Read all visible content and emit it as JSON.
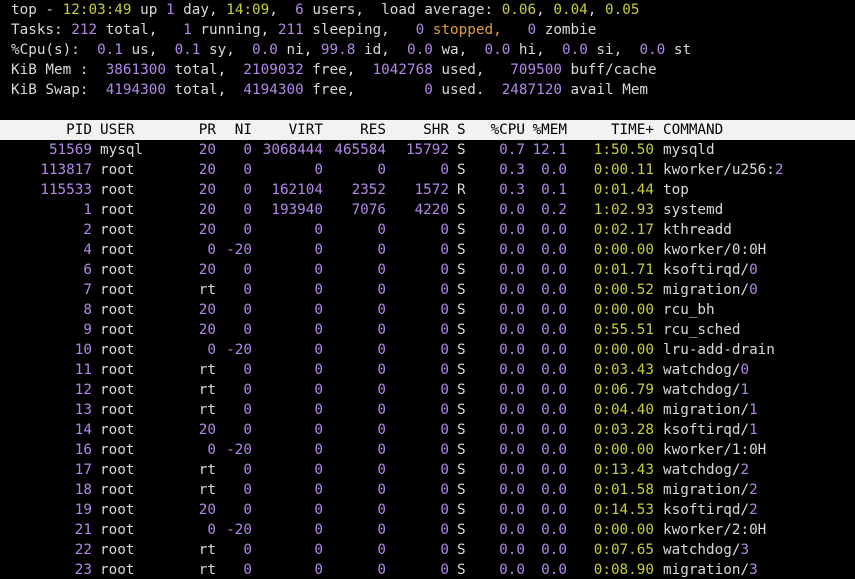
{
  "summary": {
    "top": {
      "label": "top - ",
      "time": "12:03:49",
      "up_label": " up ",
      "days": "1",
      "day_label": " day, ",
      "uptime": "14:09",
      "comma1": ",  ",
      "users": "6",
      "users_label": " users,  load average: ",
      "l1": "0.06",
      "sep1": ", ",
      "l2": "0.04",
      "sep2": ", ",
      "l3": "0.05"
    },
    "tasks": {
      "label": "Tasks: ",
      "total": "212",
      "total_label": " total,   ",
      "running": "1",
      "running_label": " running, ",
      "sleeping": "211",
      "sleeping_label": " sleeping,   ",
      "stopped": "0",
      "stopped_label": " stopped,   ",
      "zombie": "0",
      "zombie_label": " zombie"
    },
    "cpu": {
      "label": "%Cpu(s):  ",
      "us": "0.1",
      "us_label": " us,  ",
      "sy": "0.1",
      "sy_label": " sy,  ",
      "ni": "0.0",
      "ni_label": " ni, ",
      "id": "99.8",
      "id_label": " id,  ",
      "wa": "0.0",
      "wa_label": " wa,  ",
      "hi": "0.0",
      "hi_label": " hi,  ",
      "si": "0.0",
      "si_label": " si,  ",
      "st": "0.0",
      "st_label": " st"
    },
    "mem": {
      "label": "KiB Mem :  ",
      "total": "3861300",
      "total_label": " total,  ",
      "free": "2109032",
      "free_label": " free,  ",
      "used": "1042768",
      "used_label": " used,   ",
      "cache": "709500",
      "cache_label": " buff/cache"
    },
    "swap": {
      "label": "KiB Swap:  ",
      "total": "4194300",
      "total_label": " total,  ",
      "free": "4194300",
      "free_label": " free,        ",
      "used": "0",
      "used_label": " used.  ",
      "avail": "2487120",
      "avail_label": " avail Mem"
    }
  },
  "columns": [
    "PID",
    "USER",
    "PR",
    "NI",
    "VIRT",
    "RES",
    "SHR",
    "S",
    "%CPU",
    "%MEM",
    "TIME+",
    "COMMAND"
  ],
  "processes": [
    {
      "pid": "51569",
      "user": "mysql",
      "pr": "20",
      "ni": "0",
      "virt": "3068444",
      "res": "465584",
      "shr": "15792",
      "s": "S",
      "cpu": "0.7",
      "mem": "12.1",
      "time": "1:50.50",
      "cmd": "mysqld",
      "cmd_num": ""
    },
    {
      "pid": "113817",
      "user": "root",
      "pr": "20",
      "ni": "0",
      "virt": "0",
      "res": "0",
      "shr": "0",
      "s": "S",
      "cpu": "0.3",
      "mem": "0.0",
      "time": "0:00.11",
      "cmd": "kworker/u256:",
      "cmd_num": "2"
    },
    {
      "pid": "115533",
      "user": "root",
      "pr": "20",
      "ni": "0",
      "virt": "162104",
      "res": "2352",
      "shr": "1572",
      "s": "R",
      "cpu": "0.3",
      "mem": "0.1",
      "time": "0:01.44",
      "cmd": "top",
      "cmd_num": ""
    },
    {
      "pid": "1",
      "user": "root",
      "pr": "20",
      "ni": "0",
      "virt": "193940",
      "res": "7076",
      "shr": "4220",
      "s": "S",
      "cpu": "0.0",
      "mem": "0.2",
      "time": "1:02.93",
      "cmd": "systemd",
      "cmd_num": ""
    },
    {
      "pid": "2",
      "user": "root",
      "pr": "20",
      "ni": "0",
      "virt": "0",
      "res": "0",
      "shr": "0",
      "s": "S",
      "cpu": "0.0",
      "mem": "0.0",
      "time": "0:02.17",
      "cmd": "kthreadd",
      "cmd_num": ""
    },
    {
      "pid": "4",
      "user": "root",
      "pr": "0",
      "ni": "-20",
      "virt": "0",
      "res": "0",
      "shr": "0",
      "s": "S",
      "cpu": "0.0",
      "mem": "0.0",
      "time": "0:00.00",
      "cmd": "kworker/0:0H",
      "cmd_num": ""
    },
    {
      "pid": "6",
      "user": "root",
      "pr": "20",
      "ni": "0",
      "virt": "0",
      "res": "0",
      "shr": "0",
      "s": "S",
      "cpu": "0.0",
      "mem": "0.0",
      "time": "0:01.71",
      "cmd": "ksoftirqd/",
      "cmd_num": "0"
    },
    {
      "pid": "7",
      "user": "root",
      "pr": "rt",
      "ni": "0",
      "virt": "0",
      "res": "0",
      "shr": "0",
      "s": "S",
      "cpu": "0.0",
      "mem": "0.0",
      "time": "0:00.52",
      "cmd": "migration/",
      "cmd_num": "0"
    },
    {
      "pid": "8",
      "user": "root",
      "pr": "20",
      "ni": "0",
      "virt": "0",
      "res": "0",
      "shr": "0",
      "s": "S",
      "cpu": "0.0",
      "mem": "0.0",
      "time": "0:00.00",
      "cmd": "rcu_bh",
      "cmd_num": ""
    },
    {
      "pid": "9",
      "user": "root",
      "pr": "20",
      "ni": "0",
      "virt": "0",
      "res": "0",
      "shr": "0",
      "s": "S",
      "cpu": "0.0",
      "mem": "0.0",
      "time": "0:55.51",
      "cmd": "rcu_sched",
      "cmd_num": ""
    },
    {
      "pid": "10",
      "user": "root",
      "pr": "0",
      "ni": "-20",
      "virt": "0",
      "res": "0",
      "shr": "0",
      "s": "S",
      "cpu": "0.0",
      "mem": "0.0",
      "time": "0:00.00",
      "cmd": "lru-add-drain",
      "cmd_num": ""
    },
    {
      "pid": "11",
      "user": "root",
      "pr": "rt",
      "ni": "0",
      "virt": "0",
      "res": "0",
      "shr": "0",
      "s": "S",
      "cpu": "0.0",
      "mem": "0.0",
      "time": "0:03.43",
      "cmd": "watchdog/",
      "cmd_num": "0"
    },
    {
      "pid": "12",
      "user": "root",
      "pr": "rt",
      "ni": "0",
      "virt": "0",
      "res": "0",
      "shr": "0",
      "s": "S",
      "cpu": "0.0",
      "mem": "0.0",
      "time": "0:06.79",
      "cmd": "watchdog/",
      "cmd_num": "1"
    },
    {
      "pid": "13",
      "user": "root",
      "pr": "rt",
      "ni": "0",
      "virt": "0",
      "res": "0",
      "shr": "0",
      "s": "S",
      "cpu": "0.0",
      "mem": "0.0",
      "time": "0:04.40",
      "cmd": "migration/",
      "cmd_num": "1"
    },
    {
      "pid": "14",
      "user": "root",
      "pr": "20",
      "ni": "0",
      "virt": "0",
      "res": "0",
      "shr": "0",
      "s": "S",
      "cpu": "0.0",
      "mem": "0.0",
      "time": "0:03.28",
      "cmd": "ksoftirqd/",
      "cmd_num": "1"
    },
    {
      "pid": "16",
      "user": "root",
      "pr": "0",
      "ni": "-20",
      "virt": "0",
      "res": "0",
      "shr": "0",
      "s": "S",
      "cpu": "0.0",
      "mem": "0.0",
      "time": "0:00.00",
      "cmd": "kworker/1:0H",
      "cmd_num": ""
    },
    {
      "pid": "17",
      "user": "root",
      "pr": "rt",
      "ni": "0",
      "virt": "0",
      "res": "0",
      "shr": "0",
      "s": "S",
      "cpu": "0.0",
      "mem": "0.0",
      "time": "0:13.43",
      "cmd": "watchdog/",
      "cmd_num": "2"
    },
    {
      "pid": "18",
      "user": "root",
      "pr": "rt",
      "ni": "0",
      "virt": "0",
      "res": "0",
      "shr": "0",
      "s": "S",
      "cpu": "0.0",
      "mem": "0.0",
      "time": "0:01.58",
      "cmd": "migration/",
      "cmd_num": "2"
    },
    {
      "pid": "19",
      "user": "root",
      "pr": "20",
      "ni": "0",
      "virt": "0",
      "res": "0",
      "shr": "0",
      "s": "S",
      "cpu": "0.0",
      "mem": "0.0",
      "time": "0:14.53",
      "cmd": "ksoftirqd/",
      "cmd_num": "2"
    },
    {
      "pid": "21",
      "user": "root",
      "pr": "0",
      "ni": "-20",
      "virt": "0",
      "res": "0",
      "shr": "0",
      "s": "S",
      "cpu": "0.0",
      "mem": "0.0",
      "time": "0:00.00",
      "cmd": "kworker/2:0H",
      "cmd_num": ""
    },
    {
      "pid": "22",
      "user": "root",
      "pr": "rt",
      "ni": "0",
      "virt": "0",
      "res": "0",
      "shr": "0",
      "s": "S",
      "cpu": "0.0",
      "mem": "0.0",
      "time": "0:07.65",
      "cmd": "watchdog/",
      "cmd_num": "3"
    },
    {
      "pid": "23",
      "user": "root",
      "pr": "rt",
      "ni": "0",
      "virt": "0",
      "res": "0",
      "shr": "0",
      "s": "S",
      "cpu": "0.0",
      "mem": "0.0",
      "time": "0:08.90",
      "cmd": "migration/",
      "cmd_num": "3"
    }
  ],
  "colors": {
    "background": "#000000",
    "text": "#d8d8d8",
    "number": "#b287ea",
    "time": "#c8cc3d",
    "stopped": "#e0a040",
    "header_bg": "#f2f2f2"
  }
}
